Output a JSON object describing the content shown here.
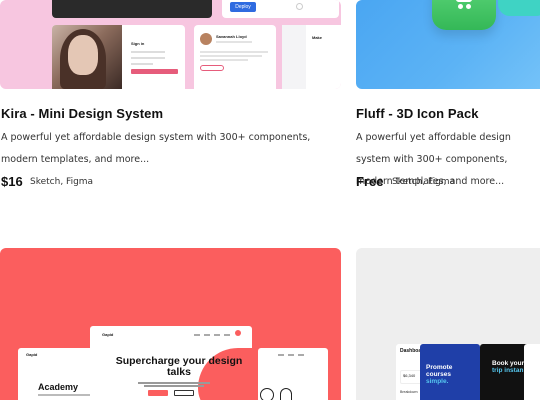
{
  "cards": [
    {
      "title": "Kira - Mini Design System",
      "description": "A powerful yet affordable design system with 300+ components, modern templates, and more...",
      "price": "$16",
      "tools": "Sketch, Figma",
      "thumb": {
        "deploy_label": "Deploy",
        "profile_name": "Savannah Lloyd",
        "signin_label": "Sign in",
        "dashboard_mark": "Make",
        "color": "#f7c6e0"
      }
    },
    {
      "title": "Fluff - 3D Icon Pack",
      "description": "A powerful yet affordable design system with 300+ components, modern templates, and more...",
      "price": "Free",
      "tools": "Sketch, Figma",
      "thumb": {
        "color": "#5cb3f5"
      }
    },
    {
      "thumb": {
        "back_heading": "Academy",
        "front_heading": "Supercharge your design talks",
        "color": "#fb5e5e"
      }
    },
    {
      "thumb": {
        "dashboard_title": "Dashboard",
        "dashboard_value": "$6,340",
        "dashboard_sub": "Breakdown",
        "blue_heading_a": "Promote",
        "blue_heading_b": "courses",
        "blue_heading_c": "simple.",
        "dark_heading_a": "Book your",
        "dark_heading_b": "trip instan",
        "color": "#eeeeee"
      }
    }
  ]
}
